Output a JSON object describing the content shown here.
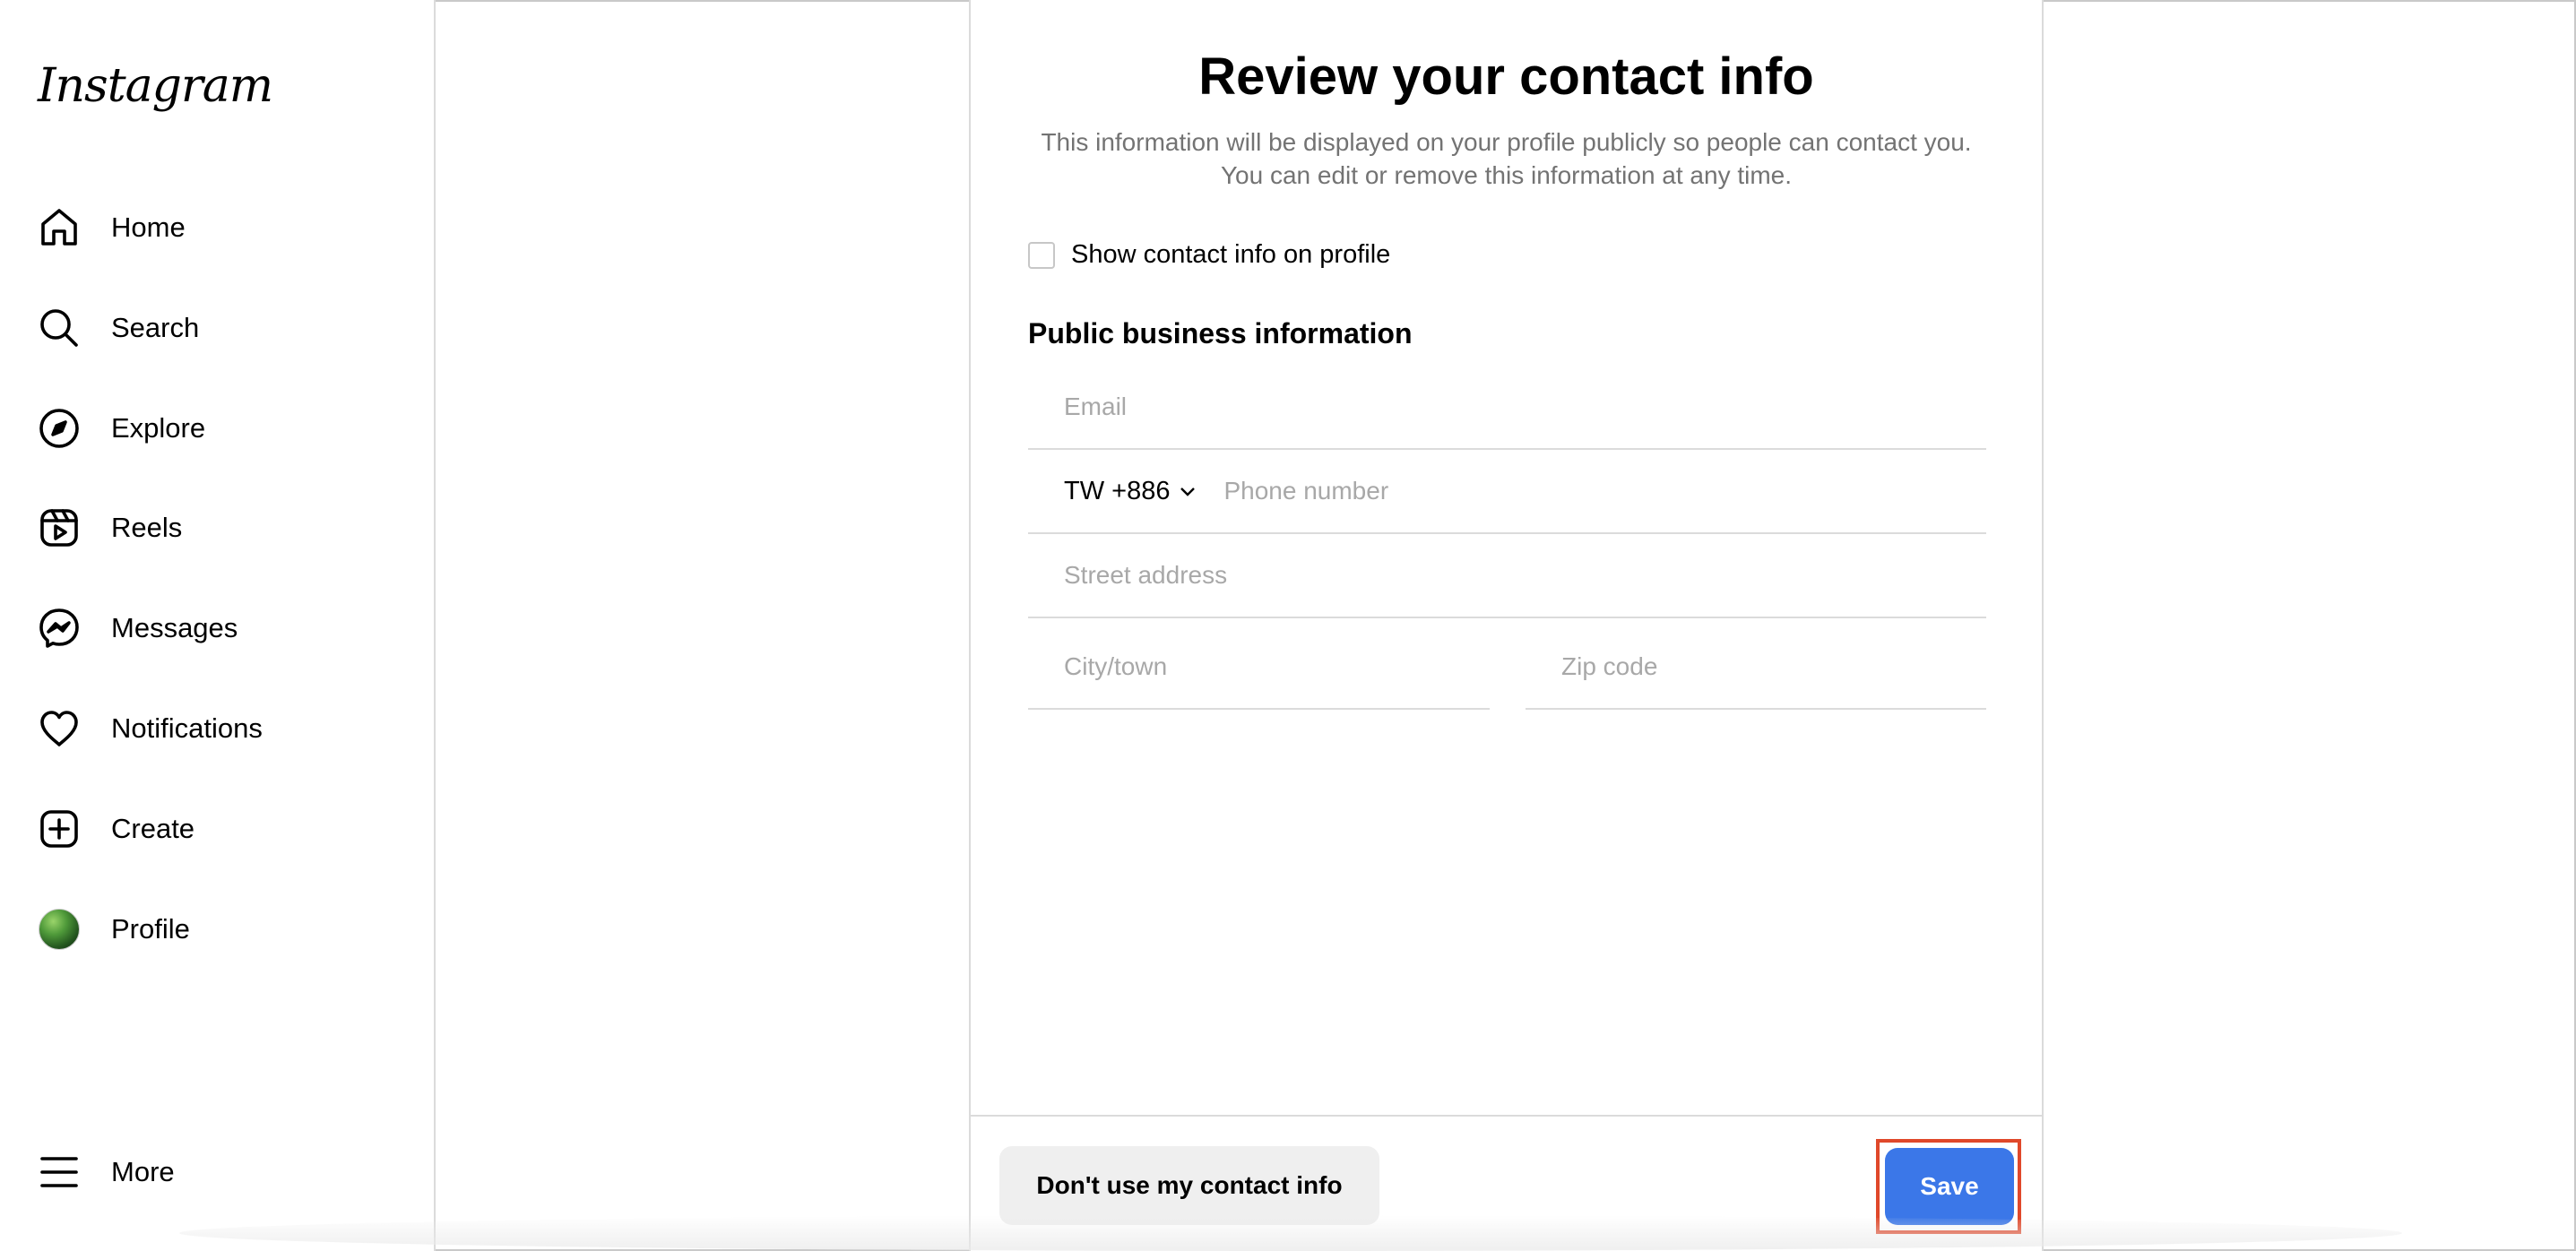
{
  "app": {
    "logo_text": "Instagram"
  },
  "sidebar": {
    "items": [
      {
        "label": "Home",
        "icon": "home-icon"
      },
      {
        "label": "Search",
        "icon": "search-icon"
      },
      {
        "label": "Explore",
        "icon": "compass-icon"
      },
      {
        "label": "Reels",
        "icon": "reels-icon"
      },
      {
        "label": "Messages",
        "icon": "messenger-icon"
      },
      {
        "label": "Notifications",
        "icon": "heart-icon"
      },
      {
        "label": "Create",
        "icon": "plus-square-icon"
      },
      {
        "label": "Profile",
        "icon": "avatar"
      }
    ],
    "more": {
      "label": "More",
      "icon": "menu-icon"
    }
  },
  "dialog": {
    "title": "Review your contact info",
    "description": "This information will be displayed on your profile publicly so people can contact you. You can edit or remove this information at any time.",
    "show_contact_label": "Show contact info on profile",
    "show_contact_checked": false,
    "section_heading": "Public business information",
    "fields": {
      "email": {
        "placeholder": "Email",
        "value": ""
      },
      "country_code": "TW +886",
      "phone": {
        "placeholder": "Phone number",
        "value": ""
      },
      "street": {
        "placeholder": "Street address",
        "value": ""
      },
      "city": {
        "placeholder": "City/town",
        "value": ""
      },
      "zip": {
        "placeholder": "Zip code",
        "value": ""
      }
    },
    "secondary_button": "Don't use my contact info",
    "primary_button": "Save"
  },
  "colors": {
    "primary_button": "#3b77e8",
    "highlight_border": "#e0482a",
    "secondary_button_bg": "#efefef",
    "muted_text": "#737373",
    "placeholder_text": "#a8a8a8",
    "divider": "#dbdbdb"
  }
}
